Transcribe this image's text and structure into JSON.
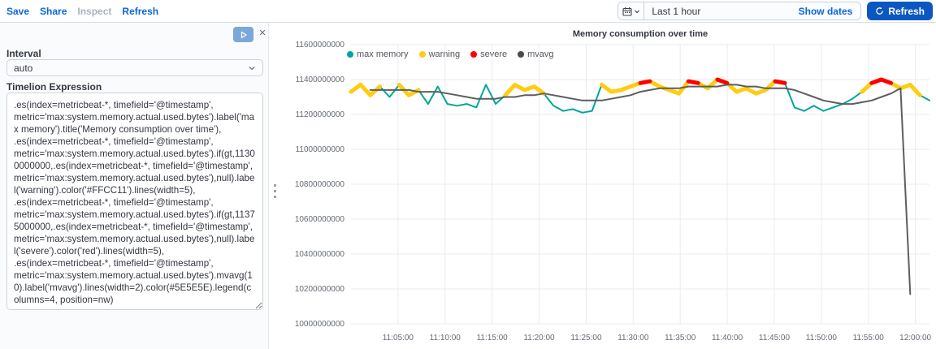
{
  "header": {
    "nav": [
      {
        "label": "Save",
        "enabled": true
      },
      {
        "label": "Share",
        "enabled": true
      },
      {
        "label": "Inspect",
        "enabled": false
      },
      {
        "label": "Refresh",
        "enabled": true
      }
    ],
    "time_picker": {
      "range_label": "Last 1 hour",
      "show_dates_label": "Show dates",
      "refresh_button_label": "Refresh"
    }
  },
  "editor": {
    "interval_label": "Interval",
    "interval_value": "auto",
    "expression_label": "Timelion Expression",
    "expression": ".es(index=metricbeat-*, timefield='@timestamp', metric='max:system.memory.actual.used.bytes').label('max memory').title('Memory consumption over time'), .es(index=metricbeat-*, timefield='@timestamp', metric='max:system.memory.actual.used.bytes').if(gt,11300000000,.es(index=metricbeat-*, timefield='@timestamp', metric='max:system.memory.actual.used.bytes'),null).label('warning').color('#FFCC11').lines(width=5), .es(index=metricbeat-*, timefield='@timestamp', metric='max:system.memory.actual.used.bytes').if(gt,11375000000,.es(index=metricbeat-*, timefield='@timestamp', metric='max:system.memory.actual.used.bytes'),null).label('severe').color('red').lines(width=5), .es(index=metricbeat-*, timefield='@timestamp', metric='max:system.memory.actual.used.bytes').mvavg(10).label('mvavg').lines(width=2).color(#5E5E5E).legend(columns=4, position=nw)"
  },
  "chart_data": {
    "type": "line",
    "title": "Memory consumption over time",
    "xlabel": "",
    "ylabel": "",
    "x_start": "11:00:00",
    "x_end": "12:00:00",
    "x_ticks": [
      "11:05:00",
      "11:10:00",
      "11:15:00",
      "11:20:00",
      "11:25:00",
      "11:30:00",
      "11:35:00",
      "11:40:00",
      "11:45:00",
      "11:50:00",
      "11:55:00",
      "12:00:00"
    ],
    "y_ticks": [
      11600000000,
      11400000000,
      11200000000,
      11000000000,
      10800000000,
      10600000000,
      10400000000,
      10200000000,
      10000000000
    ],
    "ylim": [
      10000000000,
      11600000000
    ],
    "grid": true,
    "legend_position": "nw",
    "legend_columns": 4,
    "thresholds": {
      "warning": 11300000000,
      "severe": 11375000000
    },
    "series": [
      {
        "name": "max memory",
        "color": "#00A69B",
        "width": 2,
        "values": [
          11330000000,
          11370000000,
          11310000000,
          11360000000,
          11300000000,
          11370000000,
          11310000000,
          11340000000,
          11260000000,
          11360000000,
          11260000000,
          11250000000,
          11260000000,
          11240000000,
          11370000000,
          11260000000,
          11310000000,
          11370000000,
          11340000000,
          11360000000,
          11320000000,
          11250000000,
          11220000000,
          11230000000,
          11210000000,
          11220000000,
          11370000000,
          11330000000,
          11340000000,
          11360000000,
          11380000000,
          11390000000,
          11360000000,
          11340000000,
          11320000000,
          11390000000,
          11380000000,
          11350000000,
          11400000000,
          11380000000,
          11330000000,
          11350000000,
          11320000000,
          11340000000,
          11390000000,
          11380000000,
          11240000000,
          11220000000,
          11250000000,
          11220000000,
          11240000000,
          11260000000,
          11290000000,
          11330000000,
          11380000000,
          11400000000,
          11380000000,
          11350000000,
          11370000000,
          11310000000,
          11280000000
        ]
      },
      {
        "name": "warning",
        "color": "#FFCC11",
        "width": 5,
        "values": [
          11330000000,
          11370000000,
          11310000000,
          11360000000,
          null,
          11370000000,
          11310000000,
          11340000000,
          null,
          11360000000,
          null,
          null,
          null,
          null,
          11370000000,
          null,
          11310000000,
          11370000000,
          11340000000,
          11360000000,
          11320000000,
          null,
          null,
          null,
          null,
          null,
          11370000000,
          11330000000,
          11340000000,
          11360000000,
          11380000000,
          11390000000,
          11360000000,
          11340000000,
          11320000000,
          11390000000,
          11380000000,
          11350000000,
          11400000000,
          11380000000,
          11330000000,
          11350000000,
          11320000000,
          11340000000,
          11390000000,
          11380000000,
          null,
          null,
          null,
          null,
          null,
          null,
          null,
          11330000000,
          11380000000,
          11400000000,
          11380000000,
          11350000000,
          11370000000,
          11310000000,
          null
        ]
      },
      {
        "name": "severe",
        "color": "#FF0000",
        "width": 5,
        "values": [
          null,
          null,
          null,
          null,
          null,
          null,
          null,
          null,
          null,
          null,
          null,
          null,
          null,
          null,
          null,
          null,
          null,
          null,
          null,
          null,
          null,
          null,
          null,
          null,
          null,
          null,
          null,
          null,
          null,
          null,
          11380000000,
          11390000000,
          null,
          null,
          null,
          11390000000,
          11380000000,
          null,
          11400000000,
          11380000000,
          null,
          null,
          null,
          null,
          11390000000,
          11380000000,
          null,
          null,
          null,
          null,
          null,
          null,
          null,
          null,
          11380000000,
          11400000000,
          11380000000,
          null,
          null,
          null,
          null
        ]
      },
      {
        "name": "mvavg",
        "color": "#5E5E5E",
        "width": 2,
        "values": [
          null,
          null,
          11340000000,
          11340000000,
          11340000000,
          11340000000,
          11340000000,
          11330000000,
          11330000000,
          11330000000,
          11320000000,
          11310000000,
          11300000000,
          11290000000,
          11290000000,
          11290000000,
          11300000000,
          11300000000,
          11310000000,
          11310000000,
          11320000000,
          11310000000,
          11300000000,
          11290000000,
          11280000000,
          11280000000,
          11280000000,
          11290000000,
          11300000000,
          11310000000,
          11330000000,
          11340000000,
          11350000000,
          11350000000,
          11350000000,
          11360000000,
          11360000000,
          11360000000,
          11360000000,
          11370000000,
          11370000000,
          11360000000,
          11360000000,
          11350000000,
          11350000000,
          11350000000,
          11340000000,
          11320000000,
          11300000000,
          11280000000,
          11270000000,
          11260000000,
          11260000000,
          11270000000,
          11280000000,
          11300000000,
          11320000000,
          11350000000,
          10170000000,
          null,
          null
        ]
      }
    ]
  },
  "colors": {
    "accent_blue": "#0b64dd",
    "grid_line": "#e9ebf0",
    "axis_text": "#646b74"
  }
}
